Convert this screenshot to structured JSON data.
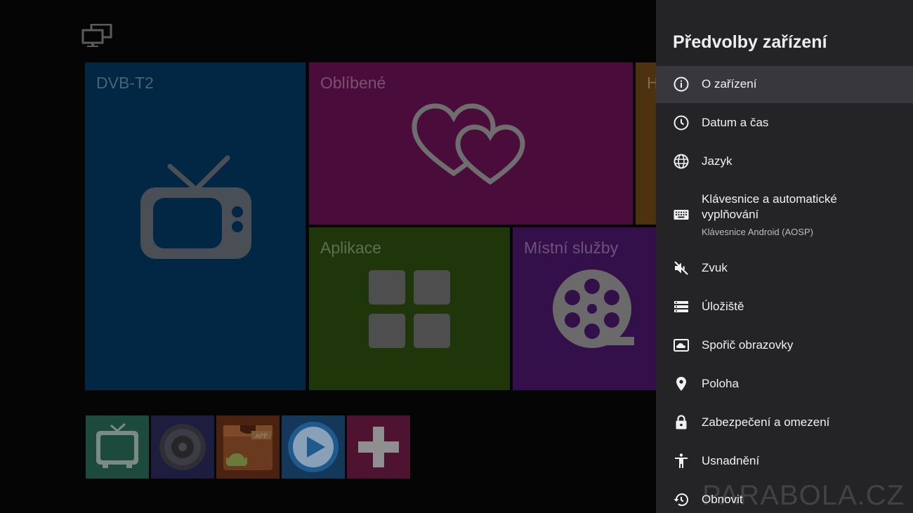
{
  "launcher": {
    "tiles": [
      {
        "title": "DVB-T2",
        "icon": "tv-icon"
      },
      {
        "title": "Oblíbené",
        "icon": "hearts-icon"
      },
      {
        "title": "H",
        "icon": ""
      },
      {
        "title": "Aplikace",
        "icon": "apps-grid-icon"
      },
      {
        "title": "Místní služby",
        "icon": "film-reel-icon"
      }
    ],
    "shortcuts": [
      "tv-icon",
      "speaker-icon",
      "app-store-icon",
      "play-icon",
      "add-icon"
    ]
  },
  "panel": {
    "title": "Předvolby zařízení",
    "items": [
      {
        "label": "O zařízení",
        "icon": "info-icon"
      },
      {
        "label": "Datum a čas",
        "icon": "clock-icon"
      },
      {
        "label": "Jazyk",
        "icon": "globe-icon"
      },
      {
        "label": "Klávesnice a automatické vyplňování",
        "sub": "Klávesnice Android (AOSP)",
        "icon": "keyboard-icon"
      },
      {
        "label": "Zvuk",
        "icon": "sound-off-icon"
      },
      {
        "label": "Úložiště",
        "icon": "storage-icon"
      },
      {
        "label": "Spořič obrazovky",
        "icon": "screensaver-icon"
      },
      {
        "label": "Poloha",
        "icon": "location-icon"
      },
      {
        "label": "Zabezpečení a omezení",
        "icon": "lock-icon"
      },
      {
        "label": "Usnadnění",
        "icon": "accessibility-icon"
      },
      {
        "label": "Obnovit",
        "icon": "restore-icon"
      }
    ]
  },
  "watermark": "PARABOLA.CZ"
}
